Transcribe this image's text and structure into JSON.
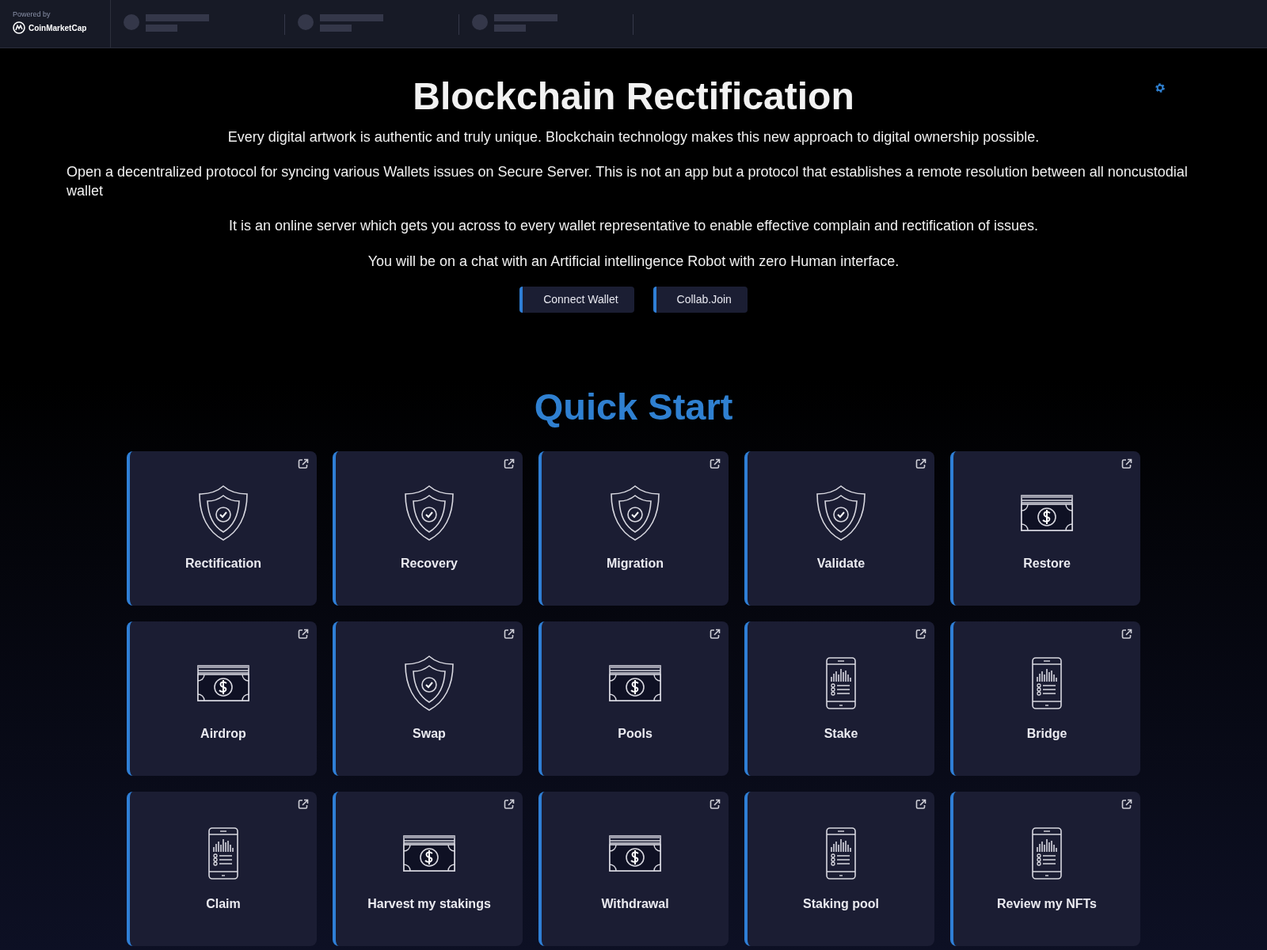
{
  "brand": {
    "powered_by": "Powered by",
    "name": "CoinMarketCap"
  },
  "title": "Blockchain Rectification",
  "paragraphs": [
    "Every digital artwork is authentic and truly unique. Blockchain technology makes this new approach to digital ownership possible.",
    "Open a decentralized protocol for syncing various Wallets issues on Secure Server. This is not an app but a protocol that establishes a remote resolution between all noncustodial wallet",
    "It is an online server which gets you across to every wallet representative to enable effective complain and rectification of issues.",
    "You will be on a chat with an Artificial intellingence Robot with zero Human interface."
  ],
  "buttons": [
    "Connect Wallet",
    "Collab.Join"
  ],
  "section_title": "Quick Start",
  "cards": [
    {
      "label": "Rectification",
      "kind": "shield"
    },
    {
      "label": "Recovery",
      "kind": "shield"
    },
    {
      "label": "Migration",
      "kind": "shield"
    },
    {
      "label": "Validate",
      "kind": "shield"
    },
    {
      "label": "Restore",
      "kind": "money"
    },
    {
      "label": "Airdrop",
      "kind": "money"
    },
    {
      "label": "Swap",
      "kind": "shield"
    },
    {
      "label": "Pools",
      "kind": "money"
    },
    {
      "label": "Stake",
      "kind": "phone"
    },
    {
      "label": "Bridge",
      "kind": "phone"
    },
    {
      "label": "Claim",
      "kind": "phone"
    },
    {
      "label": "Harvest my stakings",
      "kind": "money"
    },
    {
      "label": "Withdrawal",
      "kind": "money"
    },
    {
      "label": "Staking pool",
      "kind": "phone"
    },
    {
      "label": "Review my NFTs",
      "kind": "phone"
    }
  ]
}
